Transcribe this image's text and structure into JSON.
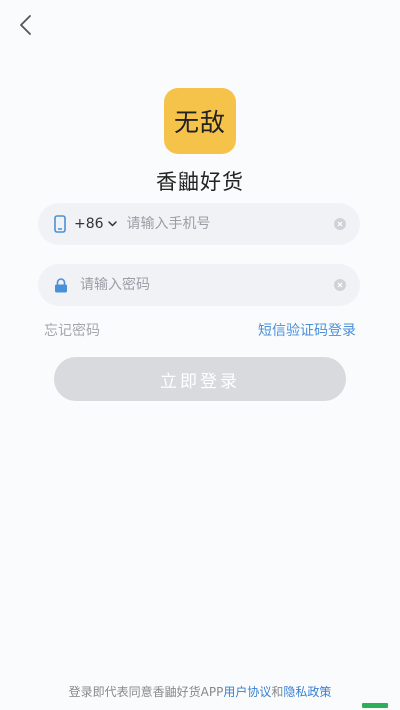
{
  "app": {
    "logo_text": "无敌",
    "name": "香鼬好货"
  },
  "phone": {
    "country_code": "+86",
    "placeholder": "请输入手机号"
  },
  "password": {
    "placeholder": "请输入密码"
  },
  "links": {
    "forgot": "忘记密码",
    "sms_login": "短信验证码登录"
  },
  "login_button": "立即登录",
  "agreement": {
    "prefix": "登录即代表同意香鼬好货APP",
    "user_agreement": "用户协议",
    "and": "和",
    "privacy_policy": "隐私政策"
  },
  "colors": {
    "logo_bg": "#f6c34a",
    "link_blue": "#4a90d9",
    "button_disabled": "#d9dadd"
  },
  "icons": [
    "back-arrow-icon",
    "phone-icon",
    "chevron-down-icon",
    "clear-icon",
    "lock-icon"
  ]
}
